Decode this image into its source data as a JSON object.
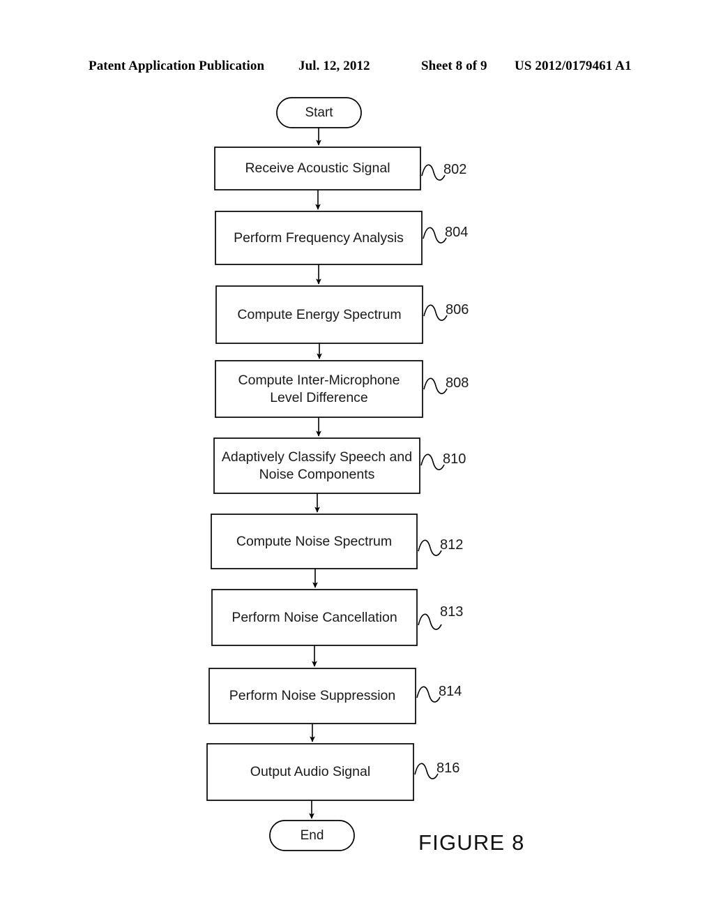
{
  "header": {
    "publication": "Patent Application Publication",
    "date": "Jul. 12, 2012",
    "sheet": "Sheet 8 of 9",
    "patent_number": "US 2012/0179461 A1"
  },
  "figure": {
    "caption": "FIGURE 8",
    "type": "flowchart",
    "line_color": "#000000",
    "text_color": "#1a1a1a",
    "background": "#ffffff"
  },
  "flowchart": {
    "start_label": "Start",
    "end_label": "End",
    "steps": [
      {
        "ref": "802",
        "label": "Receive Acoustic Signal"
      },
      {
        "ref": "804",
        "label": "Perform Frequency Analysis"
      },
      {
        "ref": "806",
        "label": "Compute Energy Spectrum"
      },
      {
        "ref": "808",
        "label": "Compute Inter-Microphone\nLevel Difference"
      },
      {
        "ref": "810",
        "label": "Adaptively Classify Speech and\nNoise Components"
      },
      {
        "ref": "812",
        "label": "Compute Noise Spectrum"
      },
      {
        "ref": "813",
        "label": "Perform Noise Cancellation"
      },
      {
        "ref": "814",
        "label": "Perform Noise Suppression"
      },
      {
        "ref": "816",
        "label": "Output Audio Signal"
      }
    ]
  }
}
